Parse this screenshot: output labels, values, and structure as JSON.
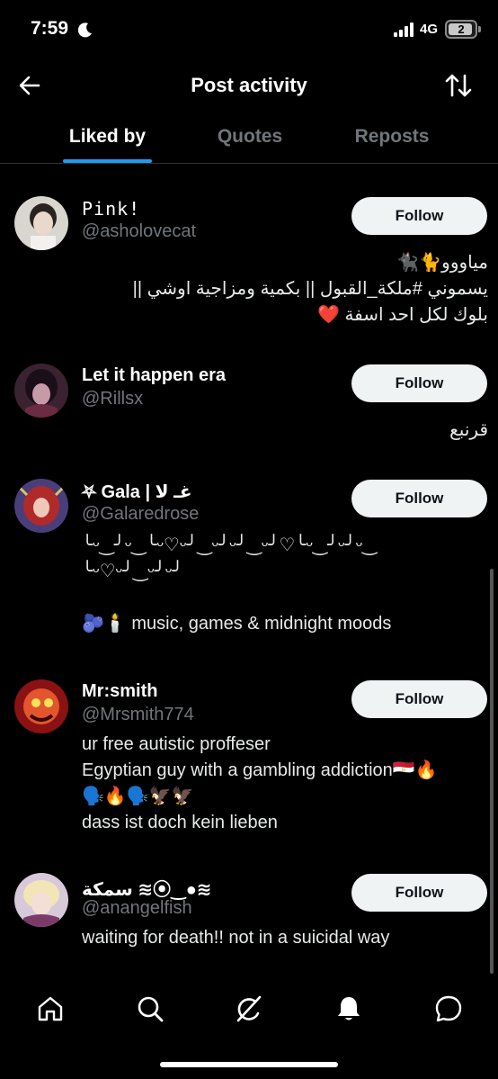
{
  "status_bar": {
    "time": "7:59",
    "network": "4G",
    "battery": "2"
  },
  "header": {
    "title": "Post activity"
  },
  "tabs": [
    {
      "label": "Liked by",
      "active": true
    },
    {
      "label": "Quotes",
      "active": false
    },
    {
      "label": "Reposts",
      "active": false
    }
  ],
  "follow_label": "Follow",
  "users": [
    {
      "name": "Pink!",
      "handle": "@asholovecat",
      "bio": [
        "مياووو🐈🐈‍⬛",
        "يسموني #ملكة_القبول || بكمية ومزاجية اوشي ||",
        "بلوك لكل احد اسفة ❤️"
      ]
    },
    {
      "name": "Let it happen era",
      "handle": "@Rillsx",
      "bio": [
        "قرنبع"
      ]
    },
    {
      "name": "⛧ Gala | غـ لا",
      "handle": "@Galaredrose",
      "bio": [
        "╰ᵕ‿╯ᵕ‿╰ᵕ♡ᵕ╯‿ᵕ╯ᵕ╯‿ᵕ╯♡╰ᵕ‿╯ᵕ╯ᵕ‿",
        "╰ᵕ♡ᵕ╯‿ᵕ╯ᵕ╯",
        "",
        "🫐🕯️ music, games & midnight moods"
      ]
    },
    {
      "name": "Mr:smith",
      "handle": "@Mrsmith774",
      "bio": [
        "ur free autistic proffeser",
        "Egyptian guy with a gambling addiction🇪🇬🔥",
        "🗣️🔥🗣️🦅🦅",
        "dass ist doch kein lieben"
      ]
    },
    {
      "name": "سمكة ≋⦿‿●≋",
      "handle": "@anangelfish",
      "bio": [
        "waiting for death!! not in a suicidal way"
      ]
    }
  ],
  "nav": [
    "home-icon",
    "search-icon",
    "grok-icon",
    "notifications-icon",
    "messages-icon"
  ],
  "colors": {
    "accent": "#1d9bf0",
    "background": "#000000",
    "muted": "#71767b"
  }
}
